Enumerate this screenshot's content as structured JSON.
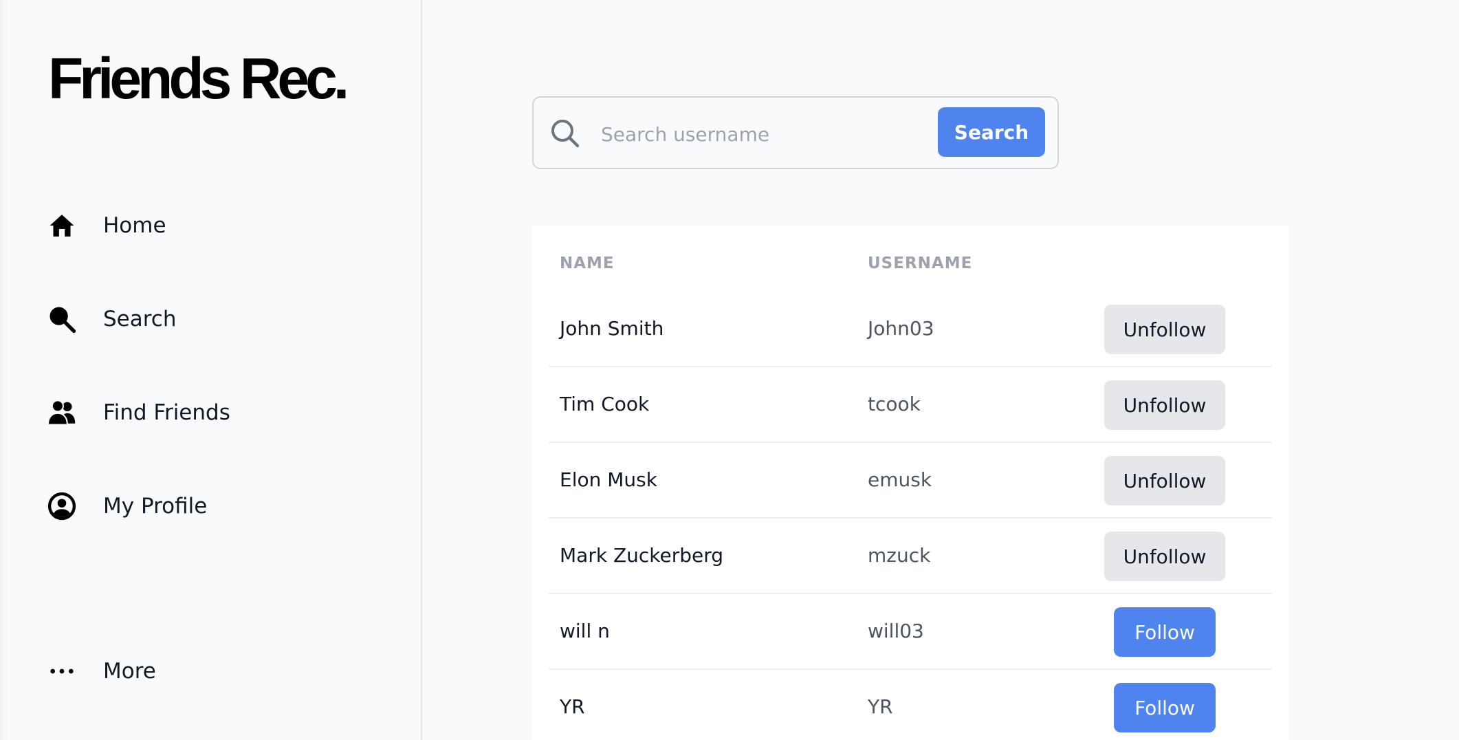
{
  "sidebar": {
    "logo": "Friends Rec.",
    "items": [
      {
        "label": "Home",
        "icon": "home-icon"
      },
      {
        "label": "Search",
        "icon": "search-icon"
      },
      {
        "label": "Find Friends",
        "icon": "users-icon"
      },
      {
        "label": "My Profile",
        "icon": "user-circle-icon"
      }
    ],
    "more_label": "More",
    "more_icon": "more-dots-icon"
  },
  "search": {
    "placeholder": "Search username",
    "value": "",
    "button_label": "Search",
    "icon": "search-icon"
  },
  "table": {
    "headers": {
      "name": "NAME",
      "username": "USERNAME"
    },
    "rows": [
      {
        "name": "John Smith",
        "username": "John03",
        "action": "Unfollow"
      },
      {
        "name": "Tim Cook",
        "username": "tcook",
        "action": "Unfollow"
      },
      {
        "name": "Elon Musk",
        "username": "emusk",
        "action": "Unfollow"
      },
      {
        "name": "Mark Zuckerberg",
        "username": "mzuck",
        "action": "Unfollow"
      },
      {
        "name": "will n",
        "username": "will03",
        "action": "Follow"
      },
      {
        "name": "YR",
        "username": "YR",
        "action": "Follow"
      }
    ]
  },
  "colors": {
    "accent": "#4f83ee",
    "secondary_button": "#e5e7eb",
    "background": "#f9fafb",
    "text": "#111827",
    "muted": "#9ca3af"
  }
}
